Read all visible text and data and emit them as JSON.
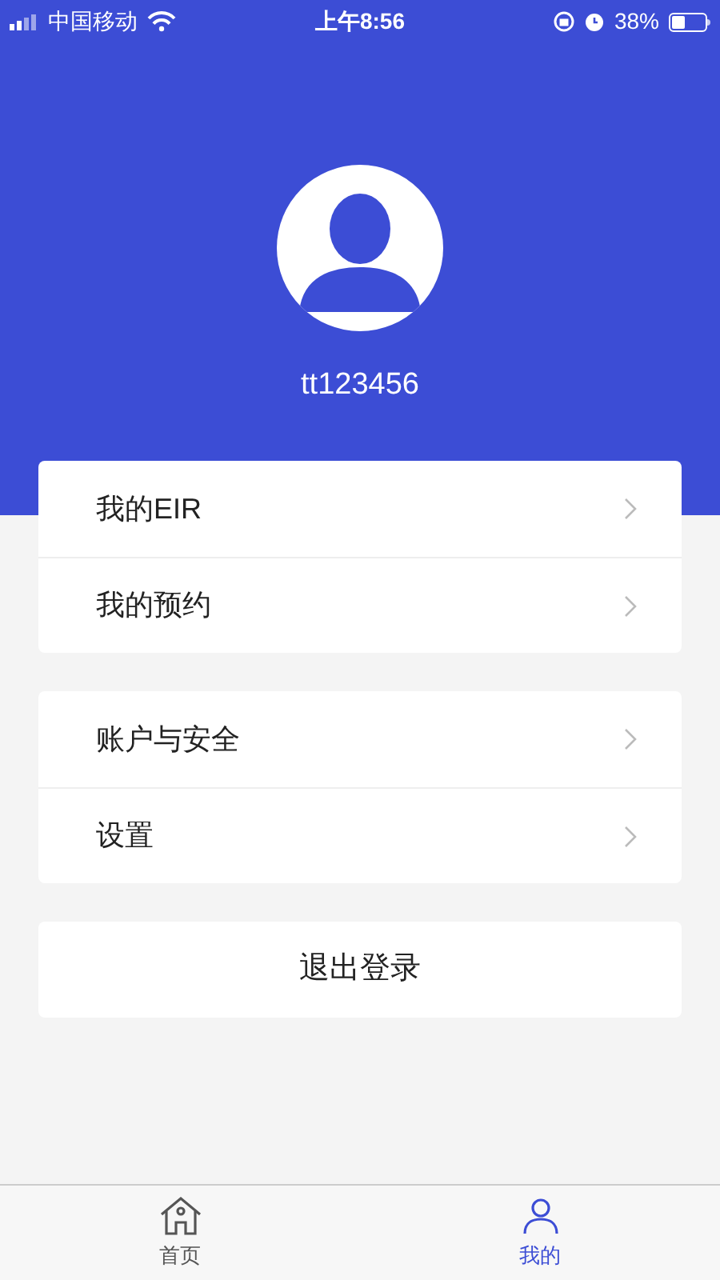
{
  "status_bar": {
    "carrier": "中国移动",
    "time": "上午8:56",
    "battery": "38%"
  },
  "profile": {
    "username": "tt123456"
  },
  "menu_groups": [
    [
      {
        "label": "我的EIR"
      },
      {
        "label": "我的预约"
      }
    ],
    [
      {
        "label": "账户与安全"
      },
      {
        "label": "设置"
      }
    ]
  ],
  "logout_button": "退出登录",
  "tab_bar": [
    {
      "label": "首页",
      "kind": "home",
      "selected": false
    },
    {
      "label": "我的",
      "kind": "profile",
      "selected": true
    }
  ]
}
